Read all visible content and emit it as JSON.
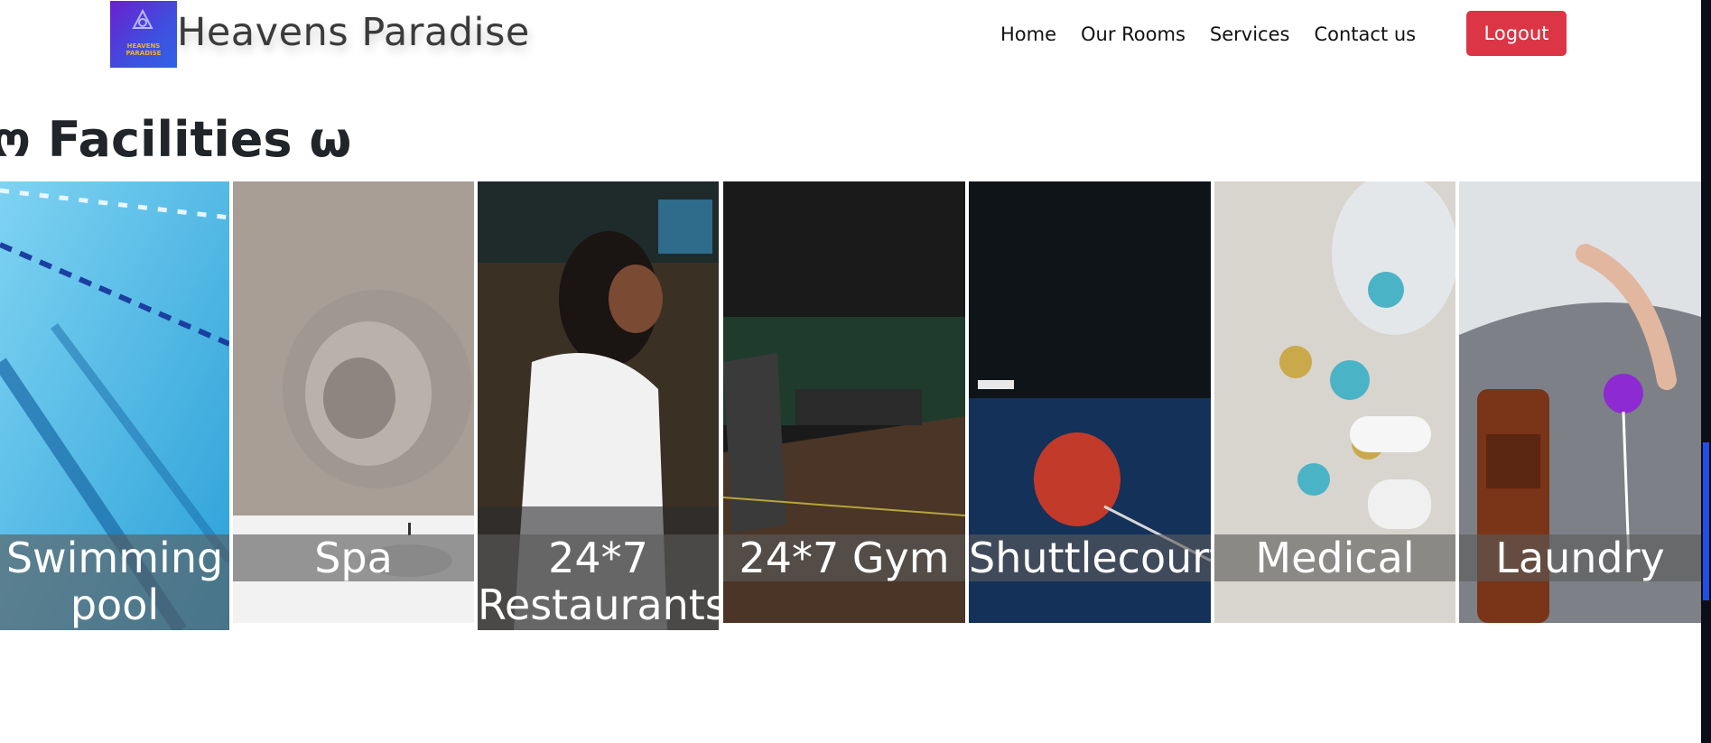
{
  "navbar": {
    "logo_text": "HEAVENS PARADISE",
    "brand": "Heavens Paradise",
    "links": [
      "Home",
      "Our Rooms",
      "Services",
      "Contact us"
    ],
    "logout": "Logout"
  },
  "section": {
    "title": "ო Facilities ω"
  },
  "facilities": [
    {
      "label": "Swimming pool"
    },
    {
      "label": "Spa"
    },
    {
      "label": "24*7 Restaurants"
    },
    {
      "label": "24*7 Gym"
    },
    {
      "label": "Shuttlecourt"
    },
    {
      "label": "Medical"
    },
    {
      "label": "Laundry"
    }
  ],
  "colors": {
    "logout": "#dc3545",
    "caption_bg": "#5a5a5a",
    "scroll_thumb": "#1f4fe6"
  }
}
